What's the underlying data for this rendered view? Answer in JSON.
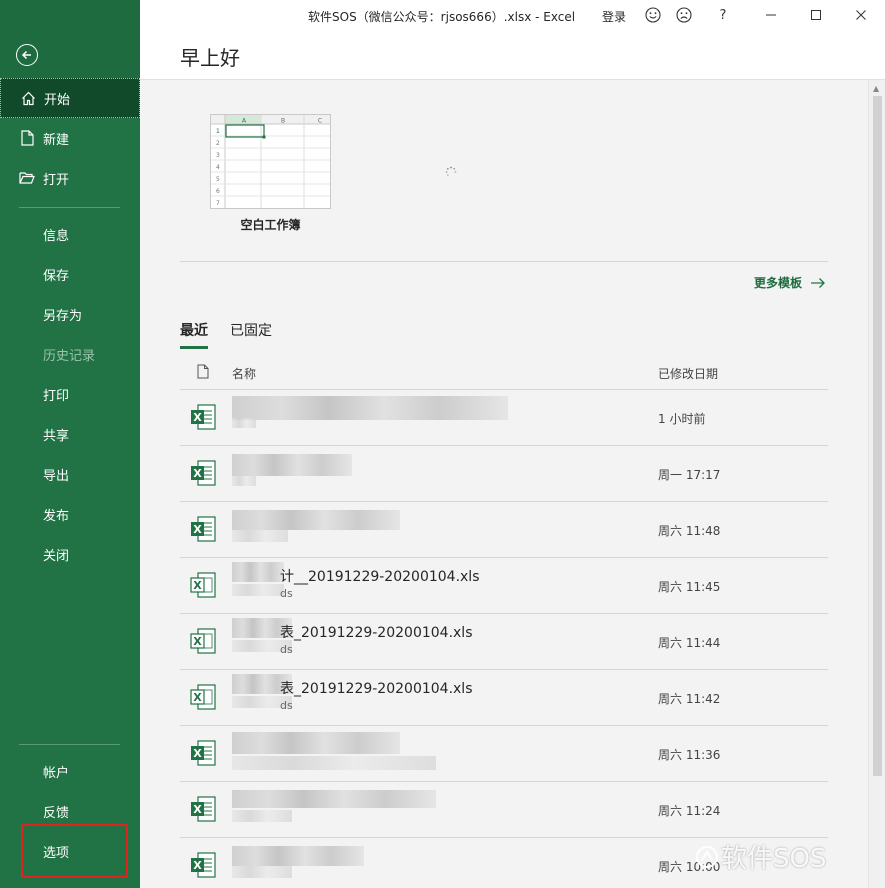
{
  "window": {
    "title": "软件SOS（微信公众号：rjsos666）.xlsx  -  Excel",
    "login": "登录",
    "help": "?"
  },
  "sidebar": {
    "top_items": [
      {
        "label": "开始",
        "icon": "home-icon"
      },
      {
        "label": "新建",
        "icon": "new-document-icon"
      },
      {
        "label": "打开",
        "icon": "folder-open-icon"
      }
    ],
    "items": [
      "信息",
      "保存",
      "另存为",
      "历史记录",
      "打印",
      "共享",
      "导出",
      "发布",
      "关闭"
    ],
    "bottom_items": [
      "帐户",
      "反馈",
      "选项"
    ]
  },
  "header": {
    "greeting": "早上好"
  },
  "templates": {
    "blank_label": "空白工作簿",
    "more_label": "更多模板"
  },
  "tabs": [
    "最近",
    "已固定"
  ],
  "list": {
    "col_name": "名称",
    "col_date": "已修改日期",
    "rows": [
      {
        "name": "",
        "sub": "",
        "date": "1 小时前"
      },
      {
        "name": "",
        "sub": "",
        "date": "周一 17:17"
      },
      {
        "name": "",
        "sub": "",
        "date": "周六 11:48"
      },
      {
        "name": "计__20191229-20200104.xls",
        "sub": "ds",
        "date": "周六 11:45"
      },
      {
        "name": "表_20191229-20200104.xls",
        "sub": "ds",
        "date": "周六 11:44"
      },
      {
        "name": "表_20191229-20200104.xls",
        "sub": "ds",
        "date": "周六 11:42"
      },
      {
        "name": "",
        "sub": "",
        "date": "周六 11:36"
      },
      {
        "name": "",
        "sub": "",
        "date": "周六 11:24"
      },
      {
        "name": "",
        "sub": "",
        "date": "周六 10:00"
      }
    ]
  },
  "watermark": "软件SOS"
}
